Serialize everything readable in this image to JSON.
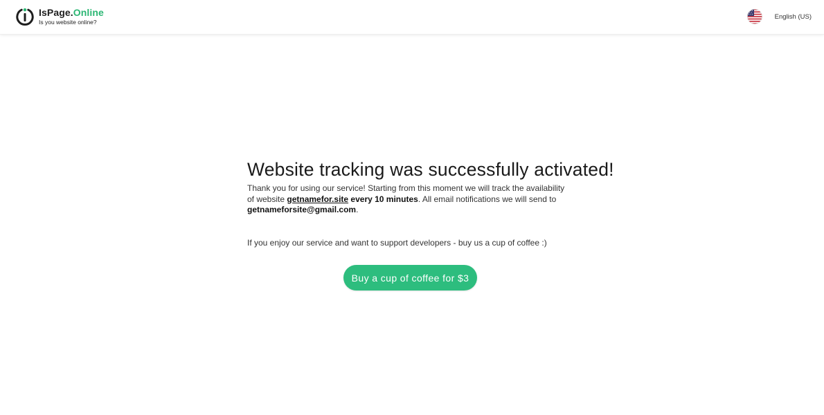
{
  "header": {
    "brand_main": "IsPage.",
    "brand_accent": "Online",
    "tagline": "Is you website online?",
    "logo_icon": "power-i-icon",
    "language_flag": "us-flag-icon",
    "language_label": "English (US)"
  },
  "main": {
    "title": "Website tracking was successfully activated!",
    "msg_part1": "Thank you for using our service! Starting from this moment we will track the availability of website ",
    "site": "getnamefor.site",
    "interval": "every 10 minutes",
    "msg_part2": ". All email notifications we will send to ",
    "email": "getnameforsite@gmail.com",
    "msg_end": ".",
    "support_text": "If you enjoy our service and want to support developers - buy us a cup of coffee :)",
    "coffee_button": "Buy a cup of coffee for $3"
  },
  "colors": {
    "accent": "#2bb673",
    "button": "#2dbd7e"
  }
}
